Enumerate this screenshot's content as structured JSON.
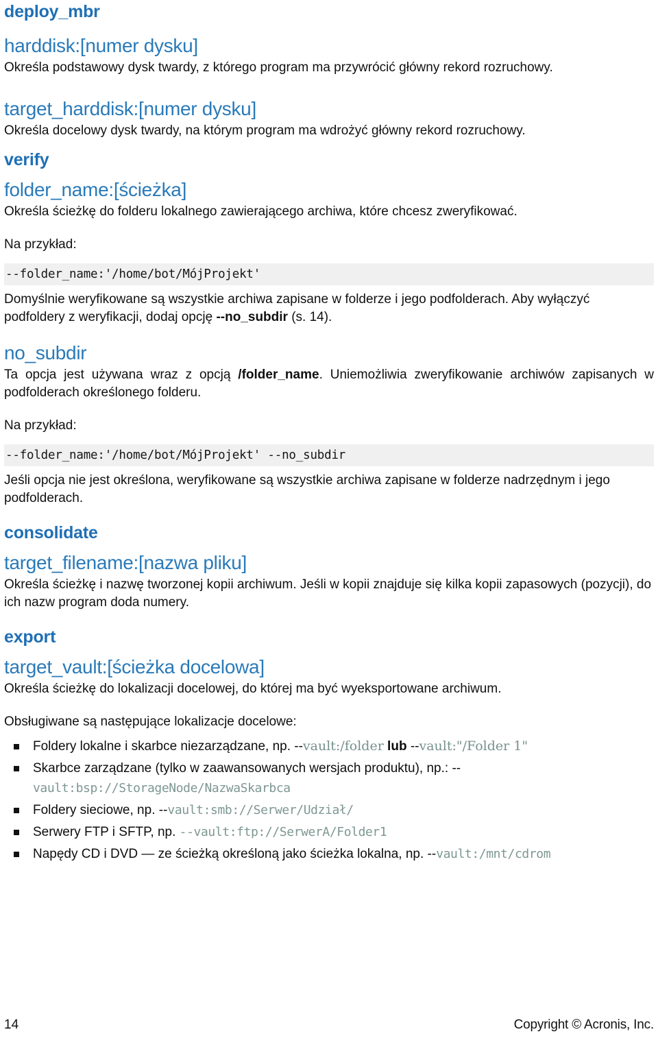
{
  "sections": [
    {
      "command": "deploy_mbr",
      "params": [
        {
          "name": "harddisk:[numer dysku]",
          "desc": "Określa podstawowy dysk twardy, z którego program ma przywrócić główny rekord rozruchowy."
        },
        {
          "name": "target_harddisk:[numer dysku]",
          "desc": "Określa docelowy dysk twardy, na którym program ma wdrożyć główny rekord rozruchowy."
        }
      ]
    },
    {
      "command": "verify",
      "params": [
        {
          "name": "folder_name:[ścieżka]",
          "desc": "Określa ścieżkę do folderu lokalnego zawierającego archiwa, które chcesz zweryfikować."
        }
      ]
    }
  ],
  "verify_block": {
    "example_label": "Na przykład:",
    "code": "--folder_name:'/home/bot/MójProjekt'",
    "note_prefix": "Domyślnie weryfikowane są wszystkie archiwa zapisane w folderze i jego podfolderach. Aby wyłączyć podfoldery z weryfikacji, dodaj opcję ",
    "note_bold": "--no_subdir",
    "note_suffix": " (s. 14)."
  },
  "no_subdir": {
    "heading": "no_subdir",
    "desc_prefix": "Ta opcja jest używana wraz z opcją ",
    "desc_bold": "/folder_name",
    "desc_suffix": ". Uniemożliwia zweryfikowanie archiwów zapisanych w podfolderach określonego folderu.",
    "example_label": "Na przykład:",
    "code": "--folder_name:'/home/bot/MójProjekt' --no_subdir",
    "tail": "Jeśli opcja nie jest określona, weryfikowane są wszystkie archiwa zapisane w folderze nadrzędnym i jego podfolderach."
  },
  "consolidate": {
    "command": "consolidate",
    "param_name": "target_filename:[nazwa pliku]",
    "desc": "Określa ścieżkę i nazwę tworzonej kopii archiwum. Jeśli w kopii znajduje się kilka kopii zapasowych (pozycji), do ich nazw program doda numery."
  },
  "export": {
    "command": "export",
    "param_name": "target_vault:[ścieżka docelowa]",
    "desc": "Określa ścieżkę do lokalizacji docelowej, do której ma być wyeksportowane archiwum.",
    "list_intro": "Obsługiwane są następujące lokalizacje docelowe:",
    "bullets": [
      {
        "parts": [
          {
            "t": "text",
            "v": "Foldery lokalne i skarbce niezarządzane, np. "
          },
          {
            "t": "plain",
            "v": "--"
          },
          {
            "t": "code",
            "v": "vault:/folder"
          },
          {
            "t": "bold",
            "v": " lub "
          },
          {
            "t": "plain",
            "v": "--"
          },
          {
            "t": "code",
            "v": "vault:\"/Folder 1\""
          }
        ]
      },
      {
        "parts": [
          {
            "t": "text",
            "v": "Skarbce zarządzane (tylko w zaawansowanych wersjach produktu), np.: "
          },
          {
            "t": "plain",
            "v": "--"
          },
          {
            "t": "codemono",
            "v": "vault:bsp://StorageNode/NazwaSkarbca"
          }
        ]
      },
      {
        "parts": [
          {
            "t": "text",
            "v": "Foldery sieciowe, np. "
          },
          {
            "t": "plain",
            "v": "--"
          },
          {
            "t": "codemono",
            "v": "vault:smb://Serwer/Udział/"
          }
        ]
      },
      {
        "parts": [
          {
            "t": "text",
            "v": "Serwery FTP i SFTP, np. "
          },
          {
            "t": "codemono",
            "v": "--vault:ftp://SerwerA/Folder1"
          }
        ]
      },
      {
        "parts": [
          {
            "t": "text",
            "v": "Napędy CD i DVD — ze ścieżką określoną jako ścieżka lokalna, np. "
          },
          {
            "t": "plain",
            "v": "--"
          },
          {
            "t": "codemono",
            "v": "vault:/mnt/cdrom"
          }
        ]
      }
    ]
  },
  "footer": {
    "page_number": "14",
    "copyright": "Copyright © Acronis, Inc."
  },
  "colors": {
    "command_heading": "#1f6fb4",
    "param_heading": "#2a7ab9",
    "code_bg": "#f0f0f0",
    "inline_code": "#76918c",
    "body_text": "#101010"
  }
}
